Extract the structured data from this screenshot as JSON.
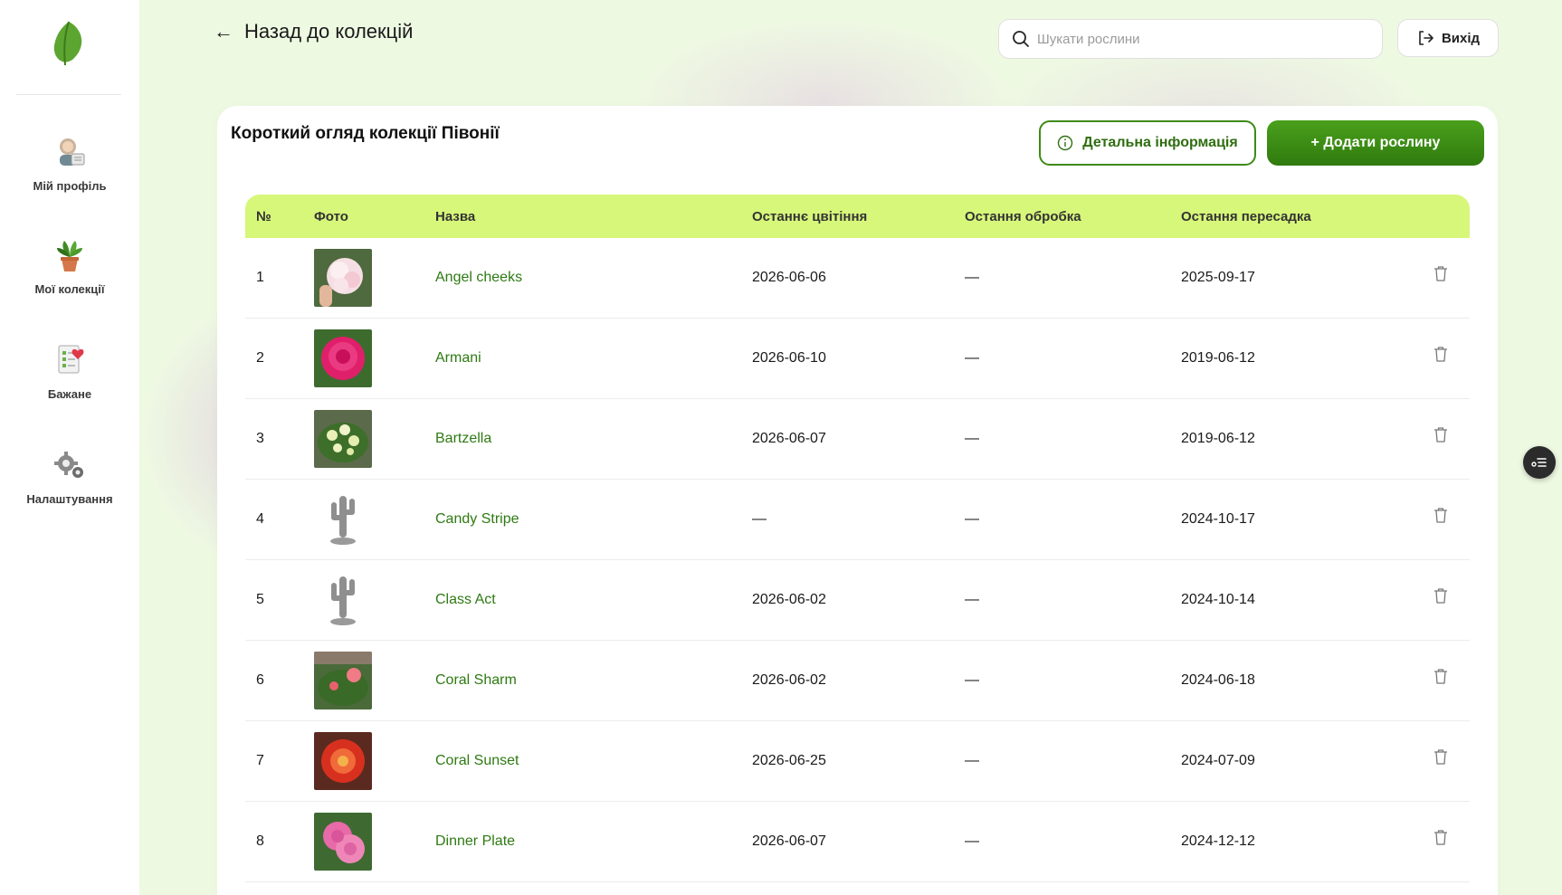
{
  "header": {
    "back_label": "Назад до колекцій",
    "search_placeholder": "Шукати рослини",
    "logout_label": "Вихід"
  },
  "sidebar": {
    "items": [
      {
        "label": "Мій профіль",
        "icon": "profile-icon"
      },
      {
        "label": "Мої колекції",
        "icon": "plant-pot-icon"
      },
      {
        "label": "Бажане",
        "icon": "wishlist-icon"
      },
      {
        "label": "Налаштування",
        "icon": "gears-icon"
      }
    ]
  },
  "card": {
    "title": "Короткий огляд колекції Півонії",
    "info_button": "Детальна інформація",
    "add_button": "+ Додати рослину"
  },
  "table": {
    "columns": [
      "№",
      "Фото",
      "Назва",
      "Останнє цвітіння",
      "Остання обробка",
      "Остання пересадка"
    ],
    "rows": [
      {
        "num": "1",
        "photo": "photo-white-pink-peony",
        "name": "Angel cheeks",
        "bloom": "2026-06-06",
        "treat": "—",
        "repot": "2025-09-17"
      },
      {
        "num": "2",
        "photo": "photo-magenta-peony",
        "name": "Armani",
        "bloom": "2026-06-10",
        "treat": "—",
        "repot": "2019-06-12"
      },
      {
        "num": "3",
        "photo": "photo-yellow-peony-bush",
        "name": "Bartzella",
        "bloom": "2026-06-07",
        "treat": "—",
        "repot": "2019-06-12"
      },
      {
        "num": "4",
        "photo": "placeholder-cactus",
        "name": "Candy Stripe",
        "bloom": "—",
        "treat": "—",
        "repot": "2024-10-17"
      },
      {
        "num": "5",
        "photo": "placeholder-cactus",
        "name": "Class Act",
        "bloom": "2026-06-02",
        "treat": "—",
        "repot": "2024-10-14"
      },
      {
        "num": "6",
        "photo": "photo-coral-peony-bush",
        "name": "Coral Sharm",
        "bloom": "2026-06-02",
        "treat": "—",
        "repot": "2024-06-18"
      },
      {
        "num": "7",
        "photo": "photo-red-coral-peony",
        "name": "Coral Sunset",
        "bloom": "2026-06-25",
        "treat": "—",
        "repot": "2024-07-09"
      },
      {
        "num": "8",
        "photo": "photo-pink-peony-double",
        "name": "Dinner Plate",
        "bloom": "2026-06-07",
        "treat": "—",
        "repot": "2024-12-12"
      }
    ]
  },
  "colors": {
    "accent": "#3d8a16",
    "table_header_bg": "#d7f77a",
    "page_bg": "#eef9e2"
  }
}
